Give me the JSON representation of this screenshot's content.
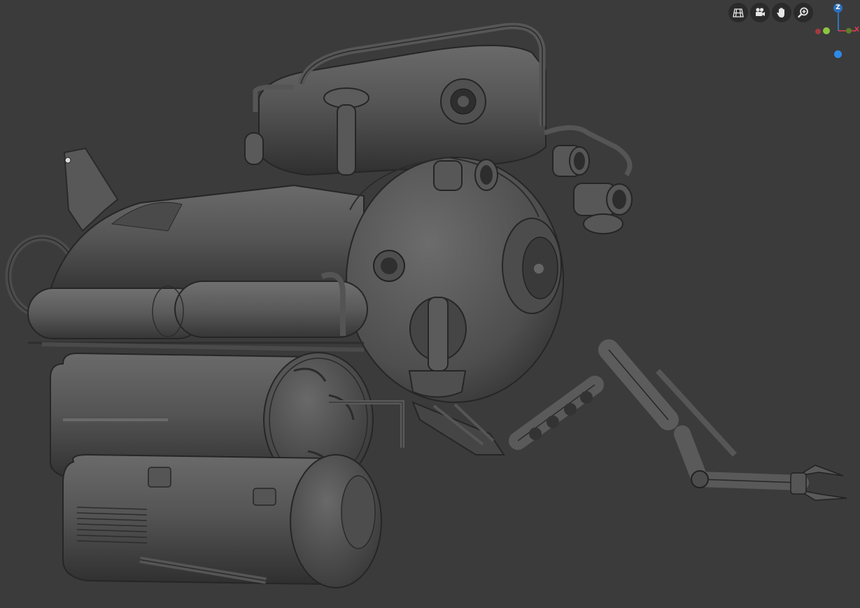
{
  "viewport": {
    "background": "#3b3b3b",
    "model": "submarine-with-robotic-arm"
  },
  "nav_tools": [
    {
      "name": "perspective-toggle",
      "icon": "grid-icon"
    },
    {
      "name": "camera",
      "icon": "camera-icon"
    },
    {
      "name": "pan",
      "icon": "hand-icon"
    },
    {
      "name": "zoom",
      "icon": "zoom-icon"
    }
  ],
  "gizmo": {
    "z_label": "Z",
    "x_label": "X",
    "colors": {
      "x": "#e04050",
      "y": "#8cc63f",
      "z": "#2e8ae6"
    }
  }
}
